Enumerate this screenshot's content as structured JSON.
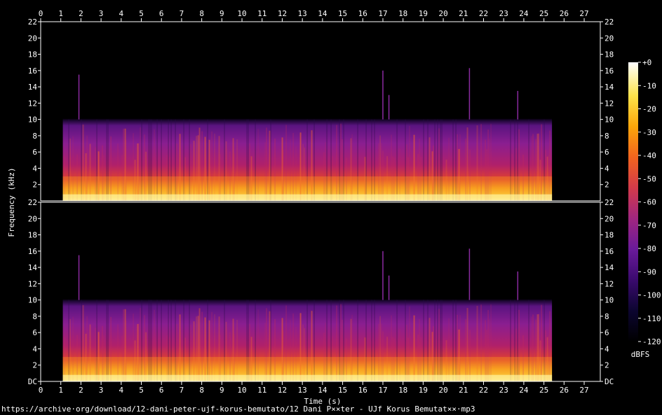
{
  "chart_data": {
    "type": "heatmap",
    "subtype": "spectrogram",
    "channels": 2,
    "xlabel": "Time (s)",
    "ylabel": "Frequency (kHz)",
    "x_ticks": [
      0,
      1,
      2,
      3,
      4,
      5,
      6,
      7,
      8,
      9,
      10,
      11,
      12,
      13,
      14,
      15,
      16,
      17,
      18,
      19,
      20,
      21,
      22,
      23,
      24,
      25,
      26,
      27
    ],
    "xlim": [
      0,
      27.8
    ],
    "y_ticks": [
      "DC",
      "2",
      "4",
      "6",
      "8",
      "10",
      "12",
      "14",
      "16",
      "18",
      "20",
      "22"
    ],
    "y_tick_values": [
      0,
      2,
      4,
      6,
      8,
      10,
      12,
      14,
      16,
      18,
      20,
      22
    ],
    "ylim": [
      0,
      22
    ],
    "audio_start_s": 1.1,
    "audio_end_s": 25.4,
    "lowpass_cutoff_khz": 10,
    "spike_times_s": [
      1.9,
      17.0,
      17.3,
      21.3,
      23.7
    ],
    "colorbar": {
      "label": "dBFS",
      "ticks": [
        "+0",
        "-10",
        "-20",
        "-30",
        "-40",
        "-50",
        "-60",
        "-70",
        "-80",
        "-90",
        "-100",
        "-110",
        "-120"
      ],
      "tick_values": [
        0,
        -10,
        -20,
        -30,
        -40,
        -50,
        -60,
        -70,
        -80,
        -90,
        -100,
        -110,
        -120
      ],
      "range": [
        -120,
        0
      ],
      "colors": [
        "#000000",
        "#0c0530",
        "#3a0a6e",
        "#6a1a9a",
        "#a02680",
        "#d33a4a",
        "#f2641e",
        "#fba60a",
        "#fde34a",
        "#ffffff"
      ]
    }
  },
  "source_url": "https://archive·org/download/12-dani-peter-ujf-korus-bemutato/12 Dani P××ter - UJf Korus Bemutat××·mp3"
}
